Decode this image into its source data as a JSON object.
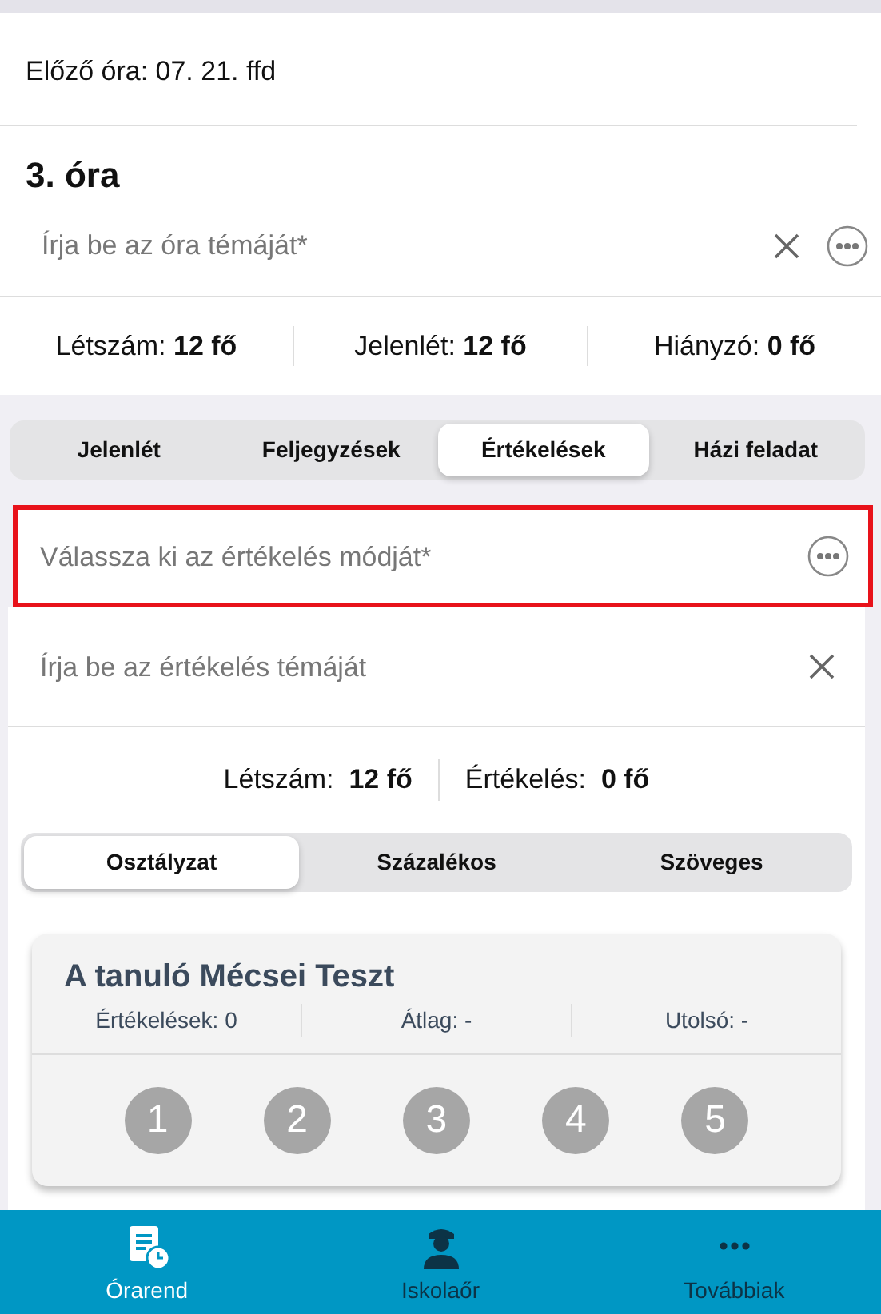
{
  "previous_lesson": "Előző óra: 07. 21. ffd",
  "lesson": {
    "title": "3. óra",
    "topic_field": {
      "placeholder": "Írja be az óra témáját*",
      "clearable": true,
      "more": true
    }
  },
  "lesson_stats": [
    "Létszám: **12 fő**",
    "Jelenlét: **12 fő**",
    "Hiányzó: **0 fő**"
  ],
  "tabs": [
    {
      "label": "Jelenlét",
      "selected": false
    },
    {
      "label": "Feljegyzések",
      "selected": false
    },
    {
      "label": "Értékelések",
      "selected": true
    },
    {
      "label": "Házi feladat",
      "selected": false
    }
  ],
  "evaluation": {
    "mode_field": {
      "placeholder": "Válassza ki az értékelés módját*",
      "error": true,
      "more": true
    },
    "topic_field": {
      "placeholder": "Írja be az értékelés témáját",
      "clearable": true,
      "more": false
    },
    "stats": [
      "Létszám:  **12 fő**",
      "Értékelés:  **0 fő**"
    ],
    "types": [
      {
        "label": "Osztályzat",
        "selected": true
      },
      {
        "label": "Százalékos",
        "selected": false
      },
      {
        "label": "Szöveges",
        "selected": false
      }
    ],
    "student": {
      "name": "A tanuló Mécsei Teszt",
      "stats": [
        "Értékelések: 0",
        "Átlag: -",
        "Utolsó: -"
      ],
      "grades": [
        "1",
        "2",
        "3",
        "4",
        "5"
      ]
    }
  },
  "bottom_nav": [
    {
      "label": "Órarend",
      "kind": "timetable",
      "selected": true
    },
    {
      "label": "Iskolaőr",
      "kind": "guard",
      "selected": false
    },
    {
      "label": "Továbbiak",
      "kind": "more",
      "selected": false
    }
  ]
}
